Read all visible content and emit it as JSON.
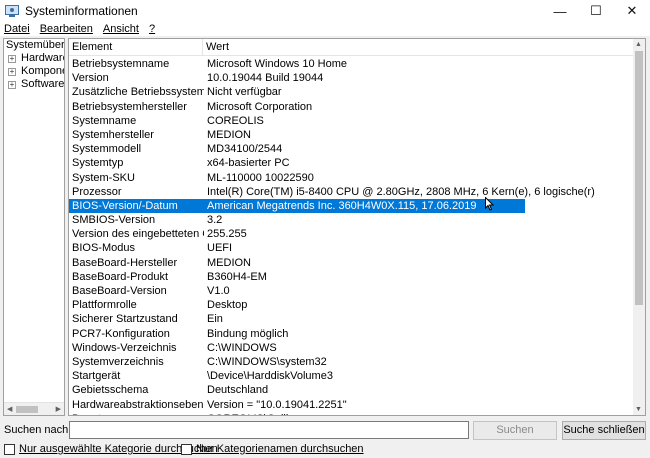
{
  "window": {
    "title": "Systeminformationen",
    "controls": {
      "minimize": "—",
      "maximize": "☐",
      "close": "✕"
    }
  },
  "menu": [
    "Datei",
    "Bearbeiten",
    "Ansicht",
    "?"
  ],
  "tree": {
    "root": "Systemübersic",
    "children": [
      "Hardwarere",
      "Komponen",
      "Softwareum"
    ]
  },
  "list": {
    "headers": [
      "Element",
      "Wert"
    ],
    "rows": [
      [
        "Betriebsystemname",
        "Microsoft Windows 10 Home"
      ],
      [
        "Version",
        "10.0.19044 Build 19044"
      ],
      [
        "Zusätzliche Betriebssystembesch...",
        "Nicht verfügbar"
      ],
      [
        "Betriebsystemhersteller",
        "Microsoft Corporation"
      ],
      [
        "Systemname",
        "COREOLIS"
      ],
      [
        "Systemhersteller",
        "MEDION"
      ],
      [
        "Systemmodell",
        "MD34100/2544"
      ],
      [
        "Systemtyp",
        "x64-basierter PC"
      ],
      [
        "System-SKU",
        "ML-110000 10022590"
      ],
      [
        "Prozessor",
        "Intel(R) Core(TM) i5-8400 CPU @ 2.80GHz, 2808 MHz, 6 Kern(e), 6 logische(r)"
      ],
      [
        "BIOS-Version/-Datum",
        "American Megatrends Inc. 360H4W0X.115, 17.06.2019"
      ],
      [
        "SMBIOS-Version",
        "3.2"
      ],
      [
        "Version des eingebetteten Cont...",
        "255.255"
      ],
      [
        "BIOS-Modus",
        "UEFI"
      ],
      [
        "BaseBoard-Hersteller",
        "MEDION"
      ],
      [
        "BaseBoard-Produkt",
        "B360H4-EM"
      ],
      [
        "BaseBoard-Version",
        "V1.0"
      ],
      [
        "Plattformrolle",
        "Desktop"
      ],
      [
        "Sicherer Startzustand",
        "Ein"
      ],
      [
        "PCR7-Konfiguration",
        "Bindung möglich"
      ],
      [
        "Windows-Verzeichnis",
        "C:\\WINDOWS"
      ],
      [
        "Systemverzeichnis",
        "C:\\WINDOWS\\system32"
      ],
      [
        "Startgerät",
        "\\Device\\HarddiskVolume3"
      ],
      [
        "Gebietsschema",
        "Deutschland"
      ],
      [
        "Hardwareabstraktionsebene",
        "Version = \"10.0.19041.2251\""
      ],
      [
        "Benutzername",
        "COREOLIS\\Caliban"
      ]
    ],
    "selected_index": 10
  },
  "search": {
    "label": "Suchen nach:",
    "value": "",
    "search_button": "Suchen",
    "close_button": "Suche schließen",
    "checkbox1": "Nur ausgewählte Kategorie durchsuchen",
    "checkbox2": "Nur Kategorienamen durchsuchen"
  },
  "colors": {
    "selection": "#0078d7"
  }
}
